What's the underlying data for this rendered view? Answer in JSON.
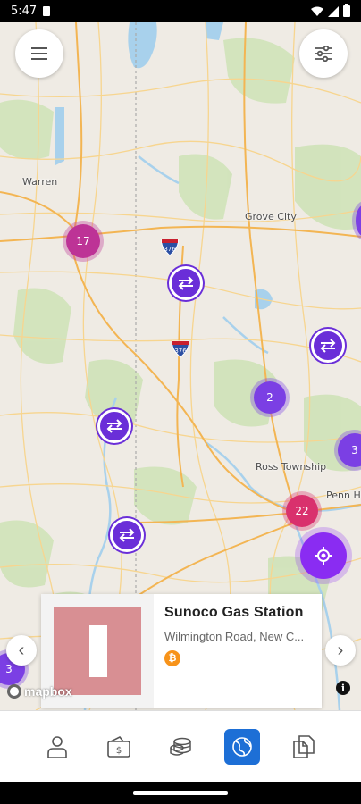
{
  "status_bar": {
    "time": "5:47"
  },
  "map": {
    "labels": {
      "warren": "Warren",
      "grove_city": "Grove City",
      "ross_township": "Ross Township",
      "penn_hills": "Penn H"
    },
    "highway_shields": {
      "i376_upper": "376",
      "i376_lower": "376"
    },
    "clusters": {
      "c17": "17",
      "c2": "2",
      "c3_right": "3",
      "c22": "22",
      "c3_left": "3"
    },
    "attribution": "mapbox",
    "info_glyph": "i"
  },
  "station_card": {
    "name": "Sunoco Gas Station",
    "address": "Wilmington Road, New C...",
    "coin_glyph": "₿"
  },
  "nav": {
    "prev_glyph": "‹",
    "next_glyph": "›"
  },
  "bottom_nav": {
    "items": [
      "profile",
      "wallet",
      "coins",
      "map",
      "documents"
    ],
    "active": "map"
  },
  "colors": {
    "cluster_purple": "#7b3fe4",
    "cluster_magenta": "#bd3396",
    "cluster_pink": "#d9316d",
    "accent_blue": "#1d6fd6",
    "locate_purple": "#8a2cf2"
  }
}
